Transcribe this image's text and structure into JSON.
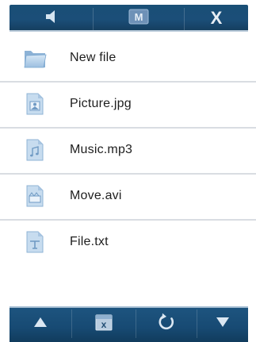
{
  "toolbar_top": {
    "buttons": [
      {
        "icon": "speaker-icon"
      },
      {
        "icon": "m-badge-icon",
        "text": "M"
      },
      {
        "icon": "close-icon",
        "text": "X"
      }
    ]
  },
  "files": [
    {
      "name": "New file",
      "icon": "folder-icon"
    },
    {
      "name": "Picture.jpg",
      "icon": "image-file-icon"
    },
    {
      "name": "Music.mp3",
      "icon": "music-file-icon"
    },
    {
      "name": "Move.avi",
      "icon": "video-file-icon"
    },
    {
      "name": "File.txt",
      "icon": "text-file-icon"
    }
  ],
  "toolbar_bottom": {
    "buttons": [
      {
        "icon": "arrow-up-icon"
      },
      {
        "icon": "delete-x-icon",
        "text": "x"
      },
      {
        "icon": "refresh-icon"
      },
      {
        "icon": "arrow-down-icon"
      }
    ]
  },
  "colors": {
    "toolbar_dark": "#174a73",
    "toolbar_highlight": "#c8d9e8",
    "icon_light_blue": "#b8d3ea",
    "icon_mid_blue": "#7aa6cf",
    "text": "#1e1e1e"
  }
}
